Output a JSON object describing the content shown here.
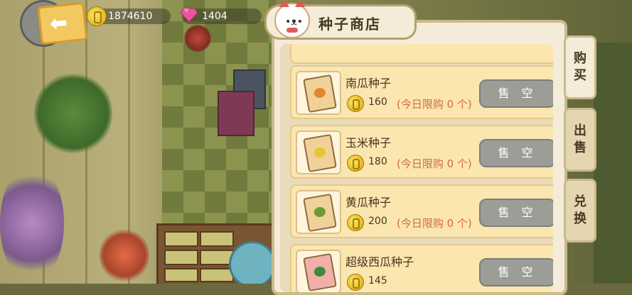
{
  "hud": {
    "coins": "1874610",
    "gems": "1404"
  },
  "shop": {
    "title": "种子商店",
    "tabs": [
      {
        "label": "购\n买"
      },
      {
        "label": "出\n售"
      },
      {
        "label": "兑\n换"
      }
    ],
    "items": [
      {
        "name": "南瓜种子",
        "price": "160",
        "limit": "(今日限购 0 个)",
        "button": "售 空",
        "veg_color": "#e0882a"
      },
      {
        "name": "玉米种子",
        "price": "180",
        "limit": "(今日限购 0 个)",
        "button": "售 空",
        "veg_color": "#e6c531"
      },
      {
        "name": "黄瓜种子",
        "price": "200",
        "limit": "(今日限购 0 个)",
        "button": "售 空",
        "veg_color": "#6e9a32"
      },
      {
        "name": "超级西瓜种子",
        "price": "145",
        "limit": "",
        "button": "售 空",
        "veg_color": "#3f8a3a"
      }
    ]
  },
  "colors": {
    "panel_bg": "#f4ecd8",
    "row_bg": "#fbe6b0",
    "limit_text": "#d06b42",
    "sold_button": "#9d9d98"
  }
}
